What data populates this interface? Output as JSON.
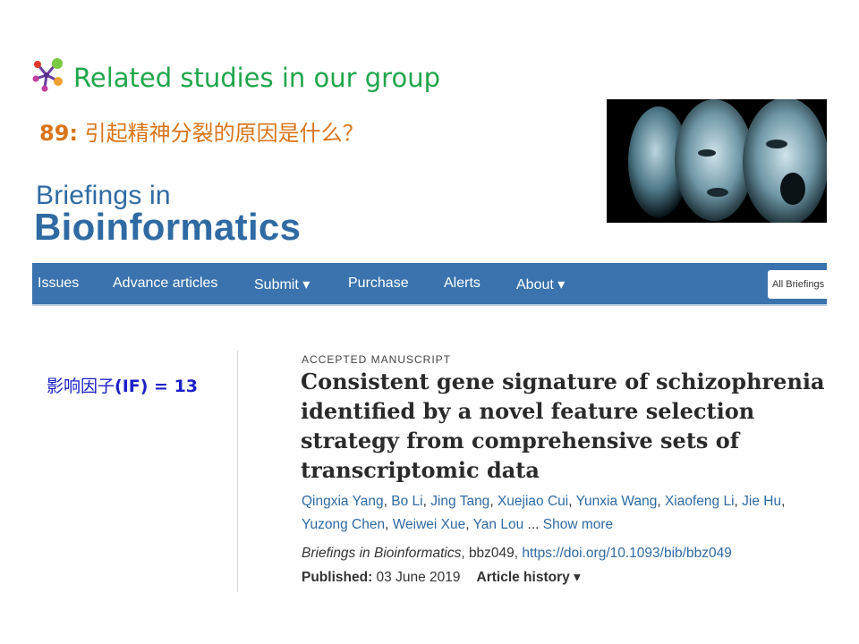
{
  "slide": {
    "heading": "Related studies in our group",
    "question_number": "89:",
    "question_text": " 引起精神分裂的原因是什么？",
    "impact_factor_label": "影响因子",
    "impact_factor_value": "(IF) = 13",
    "logo_icon": "molecule-icon"
  },
  "journal": {
    "brand_line1": "Briefings in",
    "brand_line2": "Bioinformatics",
    "brand_color": "#2f6aa3"
  },
  "nav": {
    "items": [
      "Issues",
      "Advance articles",
      "Submit ▾",
      "Purchase",
      "Alerts",
      "About ▾"
    ],
    "search_scope": "All Briefings",
    "bar_color": "#3a73ad"
  },
  "article": {
    "type": "ACCEPTED MANUSCRIPT",
    "title": "Consistent gene signature of schizophrenia identified by a novel feature selection strategy from comprehensive sets of transcriptomic data",
    "authors": [
      "Qingxia Yang",
      "Bo Li",
      "Jing Tang",
      "Xuejiao Cui",
      "Yunxia Wang",
      "Xiaofeng Li",
      "Jie Hu",
      "Yuzong Chen",
      "Weiwei Xue",
      "Yan Lou"
    ],
    "show_more": "Show more",
    "journal_name": "Briefings in Bioinformatics",
    "article_id": ", bbz049, ",
    "doi": "https://doi.org/10.1093/bib/bbz049",
    "published_label": "Published:",
    "published_date": "03 June 2019",
    "history_label": "Article history ▾"
  }
}
